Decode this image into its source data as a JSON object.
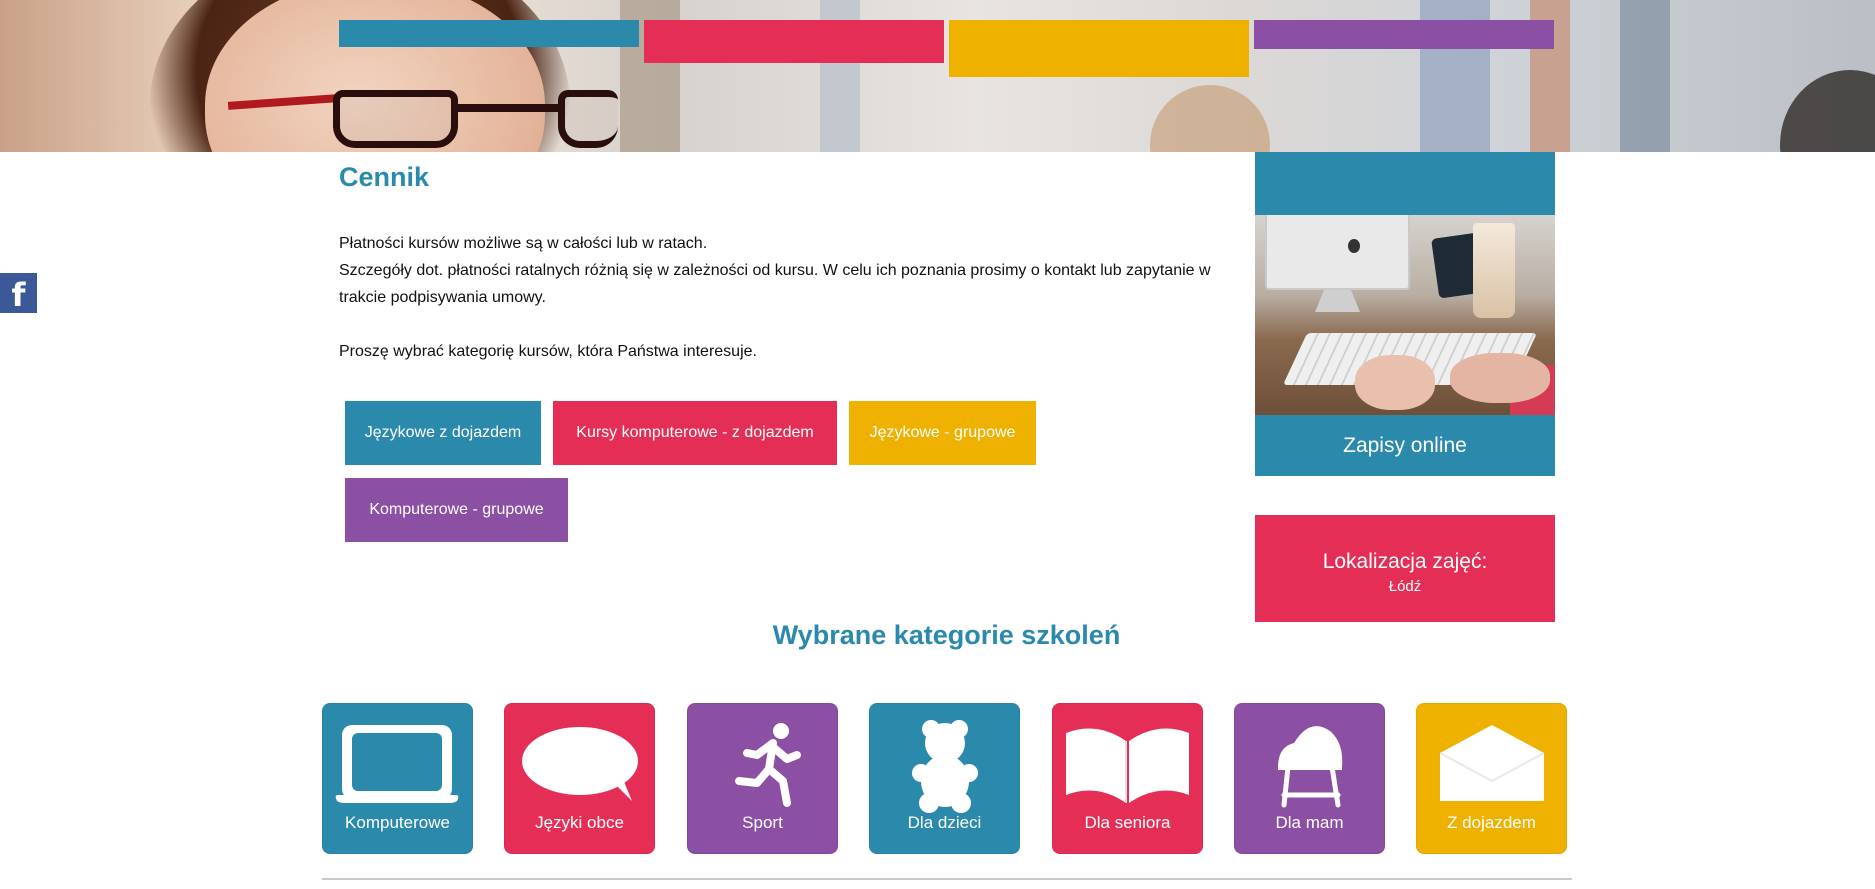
{
  "header": {
    "banner_alt": "",
    "nav_colors": [
      "#2b8aab",
      "#e42e55",
      "#eeb100",
      "#8b4fa4"
    ]
  },
  "social": {
    "facebook_icon": "facebook-icon",
    "facebook_glyph": "f"
  },
  "main": {
    "title": "Cennik",
    "paragraphs": [
      "Płatności kursów możliwe są w całości lub w ratach.",
      "Szczegóły dot. płatności ratalnych różnią się w zależności od kursu. W celu ich poznania prosimy o kontakt lub zapytanie w trakcie podpisywania umowy.",
      "",
      "Proszę wybrać kategorię kursów, która Państwa interesuje."
    ],
    "category_buttons": [
      {
        "label": "Językowe z dojazdem",
        "color": "#2b8aab"
      },
      {
        "label": "Kursy komputerowe - z dojazdem",
        "color": "#e42e55"
      },
      {
        "label": "Językowe - grupowe",
        "color": "#eeb100"
      },
      {
        "label": "Komputerowe - grupowe",
        "color": "#8b4fa4"
      }
    ]
  },
  "sidebar": {
    "signup_label": "Zapisy online",
    "location_title": "Lokalizacja zajęć:",
    "location_city": "Łódź"
  },
  "categories": {
    "title": "Wybrane kategorie szkoleń",
    "tiles": [
      {
        "label": "Komputerowe",
        "icon": "laptop-icon",
        "color": "#2b8aab"
      },
      {
        "label": "Języki obce",
        "icon": "speech-bubble-icon",
        "color": "#e42e55"
      },
      {
        "label": "Sport",
        "icon": "runner-icon",
        "color": "#8b4fa4"
      },
      {
        "label": "Dla dzieci",
        "icon": "teddy-bear-icon",
        "color": "#2b8aab"
      },
      {
        "label": "Dla seniora",
        "icon": "open-book-icon",
        "color": "#e42e55"
      },
      {
        "label": "Dla mam",
        "icon": "cradle-icon",
        "color": "#8b4fa4"
      },
      {
        "label": "Z dojazdem",
        "icon": "envelope-icon",
        "color": "#eeb100"
      }
    ]
  }
}
